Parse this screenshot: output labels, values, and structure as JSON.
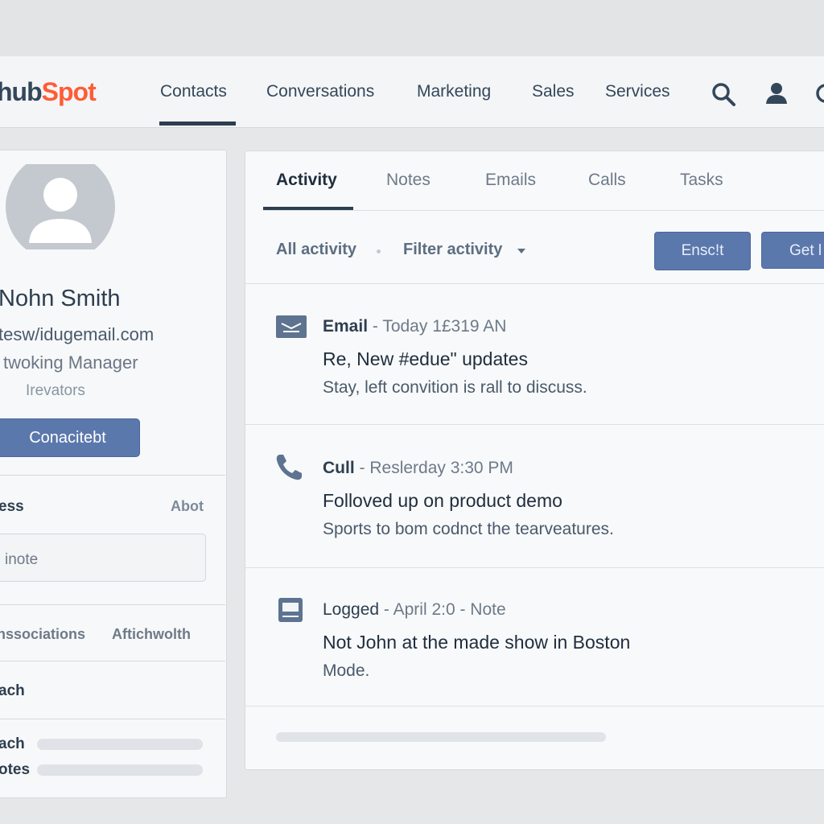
{
  "brand": {
    "name_prefix": "hub",
    "name_suffix": "Spot"
  },
  "nav": {
    "items": [
      "Contacts",
      "Conversations",
      "Marketing",
      "Sales",
      "Services"
    ],
    "icons": [
      "search-icon",
      "user-icon"
    ]
  },
  "contact": {
    "name": "Nohn Smith",
    "email": "tesw/idugemail.com",
    "title": "twoking Manager",
    "company": "Irevators",
    "button": "Conacitebt"
  },
  "sidebar": {
    "section1_label": "ess",
    "about_link": "Abot",
    "note_placeholder": "inote",
    "assoc_links": [
      "nssociations",
      "Aftichwolth"
    ],
    "section2_label": "ach",
    "list_labels": [
      "ach",
      "otes"
    ]
  },
  "tabs": [
    "Activity",
    "Notes",
    "Emails",
    "Calls",
    "Tasks"
  ],
  "filters": {
    "all": "All activity",
    "filter": "Filter activity"
  },
  "actions": {
    "primary": "Ensc!t",
    "secondary": "Get l"
  },
  "activities": [
    {
      "type": "Email",
      "meta": "Today 1£319 AN",
      "title": "Re, New #edue\" updates",
      "body": "Stay, left convition is rall to discuss.",
      "icon": "email-icon"
    },
    {
      "type": "Cull",
      "meta": "Reslerday 3:30 PM",
      "title": "Folloved up on product demo",
      "body": "Sports to bom codnct the tearveatures.",
      "icon": "phone-icon"
    },
    {
      "type": "Logged",
      "meta": "April 2:0 - Note",
      "title": "Not John at the made show in Boston",
      "body": "Mode.",
      "icon": "note-icon"
    }
  ],
  "colors": {
    "accent": "#5b78ad",
    "brand_orange": "#ff5c35",
    "text_dark": "#2d3e50"
  }
}
